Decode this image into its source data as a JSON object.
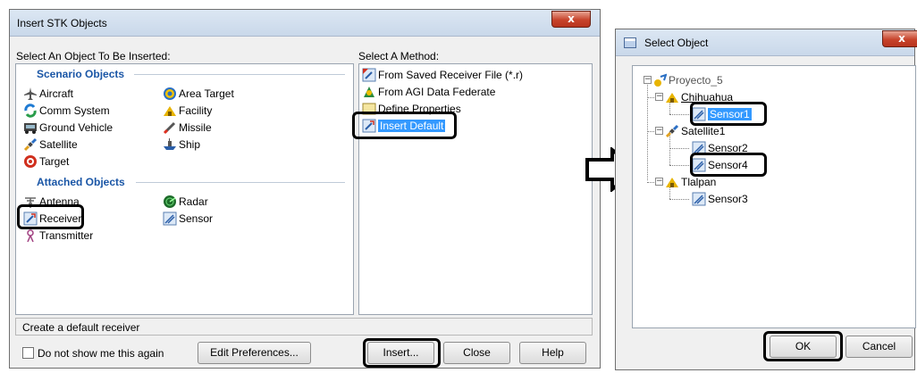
{
  "insert_dialog": {
    "title": "Insert STK Objects",
    "close_glyph": "x",
    "select_object_label": "Select An Object To Be Inserted:",
    "scenario_group": "Scenario Objects",
    "scenario_left": [
      "Aircraft",
      "Comm System",
      "Ground Vehicle",
      "Satellite",
      "Target"
    ],
    "scenario_right": [
      "Area Target",
      "Facility",
      "Missile",
      "Ship"
    ],
    "attached_group": "Attached Objects",
    "attached_left": [
      "Antenna",
      "Receiver",
      "Transmitter"
    ],
    "attached_right": [
      "Radar",
      "Sensor"
    ],
    "select_method_label": "Select A Method:",
    "methods": [
      "From Saved Receiver File (*.r)",
      "From AGI Data Federate",
      "Define Properties",
      "Insert Default"
    ],
    "description": "Create a default receiver",
    "checkbox_label": "Do not show me this again",
    "edit_prefs_label": "Edit Preferences...",
    "insert_label": "Insert...",
    "close_label": "Close",
    "help_label": "Help"
  },
  "select_dialog": {
    "title": "Select Object",
    "close_glyph": "x",
    "tree": {
      "root": "Proyecto_5",
      "nodes": [
        "Chihuahua",
        "Sensor1",
        "Satellite1",
        "Sensor2",
        "Sensor4",
        "Tlalpan",
        "Sensor3"
      ]
    },
    "ok_label": "OK",
    "cancel_label": "Cancel"
  },
  "colors": {
    "group_header": "#1a56a6",
    "selection": "#3399ff",
    "highlight_box": "#000000"
  }
}
